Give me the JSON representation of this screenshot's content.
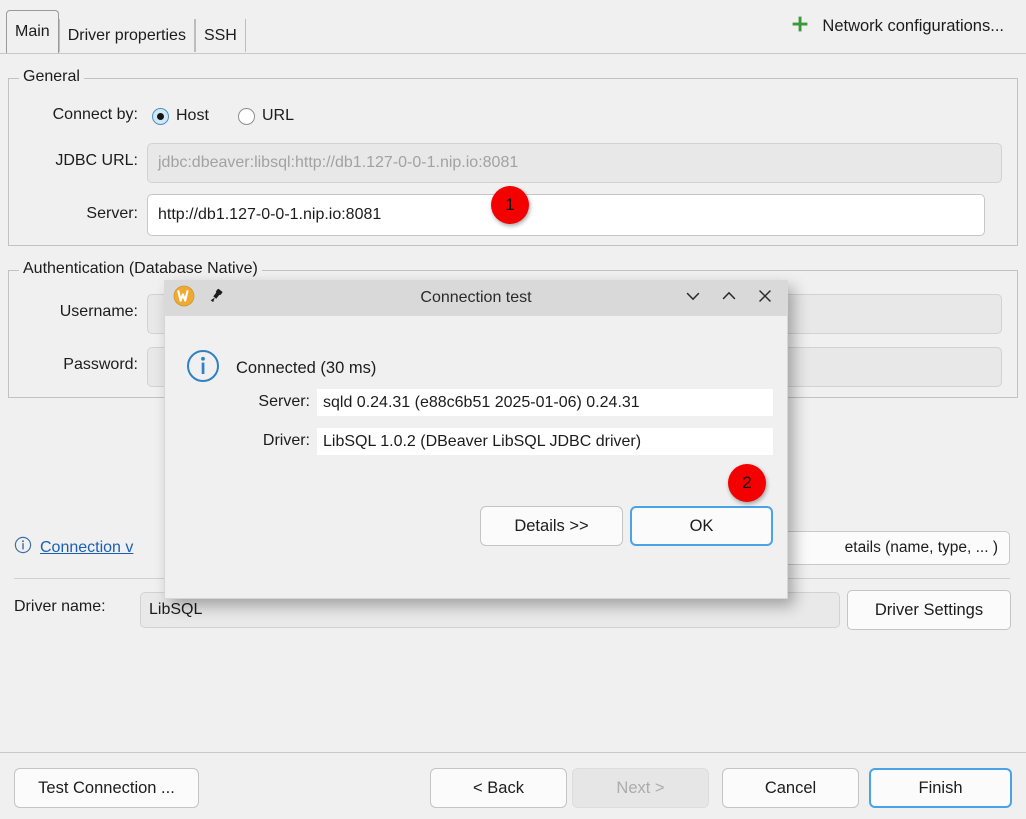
{
  "tabs": [
    {
      "label": "Main",
      "selected": true
    },
    {
      "label": "Driver properties",
      "selected": false
    },
    {
      "label": "SSH",
      "selected": false
    }
  ],
  "network_configurations": {
    "label": "Network configurations...",
    "icon": "plus-icon",
    "color": "#3a9a3a"
  },
  "general": {
    "title": "General",
    "connect_by_label": "Connect by:",
    "radio_host": "Host",
    "radio_url": "URL",
    "selected_radio": "Host",
    "jdbc_url_label": "JDBC URL:",
    "jdbc_url_value": "jdbc:dbeaver:libsql:http://db1.127-0-0-1.nip.io:8081",
    "server_label": "Server:",
    "server_value": "http://db1.127-0-0-1.nip.io:8081"
  },
  "authentication": {
    "title": "Authentication (Database Native)",
    "username_label": "Username:",
    "username_value": "",
    "password_label": "Password:",
    "password_value": ""
  },
  "connection_view": {
    "icon": "info-icon",
    "link_label": "Connection v",
    "details_button_label": "etails (name, type, ... )",
    "link_color": "#1a5fb4"
  },
  "driver": {
    "name_label": "Driver name:",
    "name_value": "LibSQL",
    "settings_button": "Driver Settings"
  },
  "wizard_buttons": {
    "test_connection": "Test Connection ...",
    "back": "< Back",
    "next": "Next >",
    "next_disabled": true,
    "cancel": "Cancel",
    "finish": "Finish",
    "finish_focused": true
  },
  "dialog": {
    "title": "Connection test",
    "app_icon": "w-logo-icon",
    "pin_icon": "pin-icon",
    "minimize_icon": "chevron-down-icon",
    "maximize_icon": "chevron-up-icon",
    "close_icon": "close-icon",
    "status_icon": "info-circle-icon",
    "status_text": "Connected (30 ms)",
    "server_label": "Server:",
    "server_value": "sqld 0.24.31 (e88c6b51 2025-01-06) 0.24.31",
    "driver_label": "Driver:",
    "driver_value": "LibSQL 1.0.2 (DBeaver LibSQL JDBC driver)",
    "details_button": "Details >>",
    "ok_button": "OK",
    "ok_focused": true
  },
  "annotations": [
    {
      "number": "1"
    },
    {
      "number": "2"
    }
  ]
}
